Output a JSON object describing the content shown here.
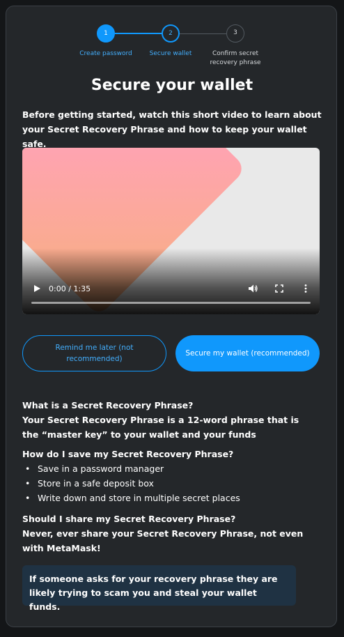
{
  "stepper": {
    "steps": [
      {
        "number": "1",
        "label": "Create password"
      },
      {
        "number": "2",
        "label": "Secure wallet"
      },
      {
        "number": "3",
        "label_line1": "Confirm secret",
        "label_line2": "recovery phrase"
      }
    ],
    "colors": {
      "active": "#1098fc",
      "inactive": "#bbc0c5"
    }
  },
  "title": "Secure your wallet",
  "intro": "Before getting started, watch this short video to learn about your Secret Recovery Phrase and how to keep your wallet safe.",
  "video": {
    "time": "0:00 / 1:35"
  },
  "buttons": {
    "remind_line1": "Remind me later (not",
    "remind_line2": "recommended)",
    "secure": "Secure my wallet (recommended)"
  },
  "faq": {
    "q1": "What is a Secret Recovery Phrase?",
    "a1": "Your Secret Recovery Phrase is a 12-word phrase that is the “master key” to your wallet and your funds",
    "q2": "How do I save my Secret Recovery Phrase?",
    "a2_items": [
      "Save in a password manager",
      "Store in a safe deposit box",
      "Write down and store in multiple secret places"
    ],
    "q3": "Should I share my Secret Recovery Phrase?",
    "a3": "Never, ever share your Secret Recovery Phrase, not even with MetaMask!"
  },
  "warning": "If someone asks for your recovery phrase they are likely trying to scam you and steal your wallet funds.",
  "icons": [
    "play-icon",
    "volume-icon",
    "fullscreen-icon",
    "more-options-icon"
  ]
}
